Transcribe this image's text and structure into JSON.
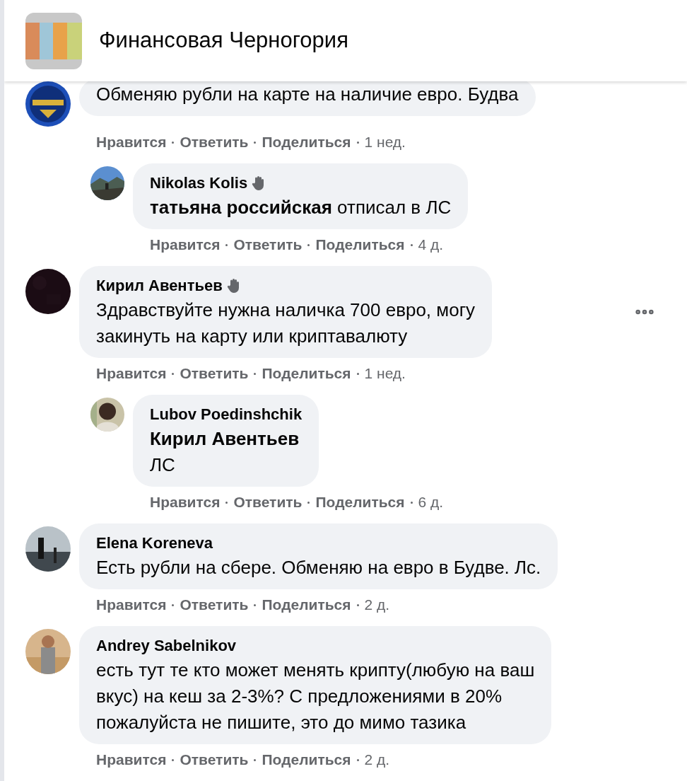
{
  "group": {
    "title": "Финансовая Черногория",
    "avatar": {
      "kind": "picture"
    }
  },
  "comments": [
    {
      "avatar": {
        "kind": "picture"
      },
      "text": "Обменяю рубли на карте на наличие евро. Будва",
      "actions": [
        "Нравится",
        "Ответить",
        "Поделиться"
      ],
      "time": "1 нед.",
      "more": false,
      "replies": [
        {
          "avatar": {
            "kind": "picture"
          },
          "author": "Nikolas Kolis",
          "text": "**татьяна российская** отписал в ЛС",
          "actions": [
            "Нравится",
            "Ответить",
            "Поделиться"
          ],
          "time": "4 д.",
          "verified": true
        }
      ]
    },
    {
      "avatar": {
        "kind": "picture"
      },
      "author": "Кирил Авентьев",
      "text": "Здравствуйте нужна наличка 700 евро, могу\nзакинуть на карту или криптавалюту",
      "actions": [
        "Нравится",
        "Ответить",
        "Поделиться"
      ],
      "time": "1 нед.",
      "verified": true,
      "more": true,
      "replies": [
        {
          "avatar": {
            "kind": "picture"
          },
          "author": "Lubov Poedinshchik",
          "text": "**Кирил Авентьев**\nЛС",
          "actions": [
            "Нравится",
            "Ответить",
            "Поделиться"
          ],
          "time": "6 д.",
          "verified": false
        }
      ]
    },
    {
      "avatar": {
        "kind": "picture"
      },
      "author": "Elena Koreneva",
      "text": "Есть рубли на сбере. Обменяю на евро в Будве. Лс.",
      "actions": [
        "Нравится",
        "Ответить",
        "Поделиться"
      ],
      "time": "2 д.",
      "verified": false,
      "more": false
    },
    {
      "avatar": {
        "kind": "picture"
      },
      "author": "Andrey Sabelnikov",
      "text": "есть тут те кто может менять крипту(любую на ваш\nвкус) на кеш за 2-3%? С предложениями в 20%\nпожалуйста не пишите, это до мимо тазика",
      "actions": [
        "Нравится",
        "Ответить",
        "Поделиться"
      ],
      "time": "2 д.",
      "verified": false,
      "more": false
    }
  ]
}
